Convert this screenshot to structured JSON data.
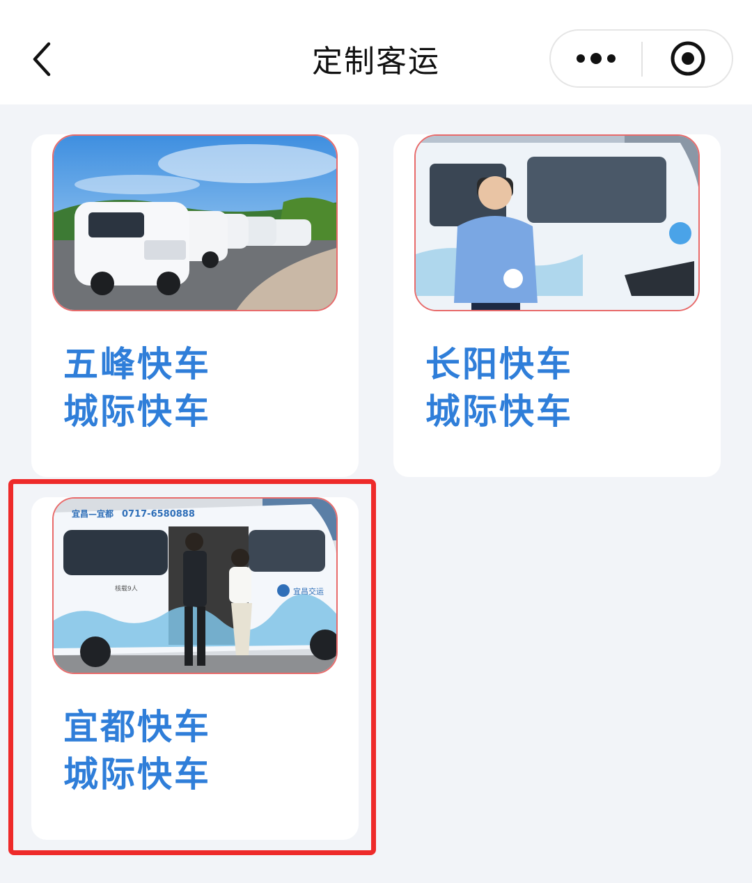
{
  "header": {
    "title": "定制客运",
    "back_icon": "chevron-left-icon",
    "more_icon": "more-dots-icon",
    "close_icon": "target-close-icon"
  },
  "cards": [
    {
      "name": "五峰快车",
      "category": "城际快车"
    },
    {
      "name": "长阳快车",
      "category": "城际快车"
    },
    {
      "name": "宜都快车",
      "category": "城际快车",
      "photo_text": {
        "route": "宜昌—宜都",
        "phone": "0717-6580888",
        "brand": "宜昌交运",
        "seats": "核载9人"
      }
    }
  ],
  "colors": {
    "accent": "#2f7ed9",
    "highlight_box": "#ee2a2a",
    "background": "#f2f4f8"
  }
}
